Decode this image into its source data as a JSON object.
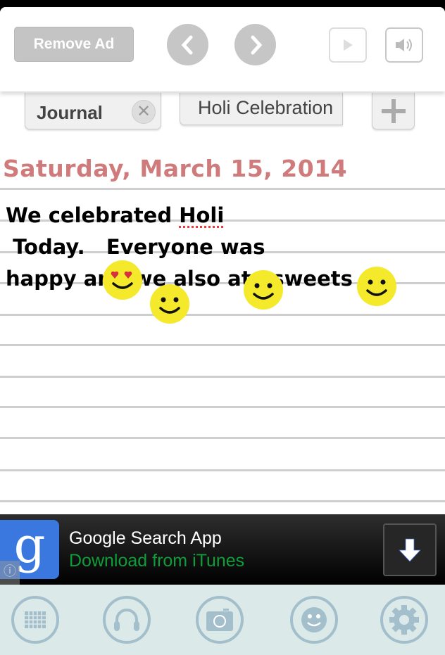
{
  "toolbar": {
    "remove_ad": "Remove Ad",
    "icons": [
      "chevron-left-icon",
      "chevron-right-icon",
      "play-icon",
      "speaker-icon"
    ]
  },
  "tabs": [
    {
      "label": "Journal"
    },
    {
      "label": "Holi Celebration"
    }
  ],
  "entry": {
    "date": "Saturday, March 15, 2014",
    "line1_pre": "We celebrated ",
    "line1_misspelled": "Holi",
    "line1_post": " Today.   Everyone was",
    "line2": "happy and we also ate sweets :-)"
  },
  "ad": {
    "title": "Google Search App",
    "subtitle": "Download from iTunes",
    "logo_letter": "g",
    "colors": {
      "subtitle": "#0f9d3a",
      "logo_bg": "#3a78e0"
    }
  },
  "bottom_bar": {
    "icons": [
      "calendar-grid-icon",
      "headphones-icon",
      "camera-icon",
      "smiley-icon",
      "gear-icon"
    ]
  },
  "colors": {
    "date": "#d07b7b",
    "bottom_bg": "#dce9e9",
    "bottom_icon": "#a3bfcc",
    "emoji": "#f4e92a"
  }
}
